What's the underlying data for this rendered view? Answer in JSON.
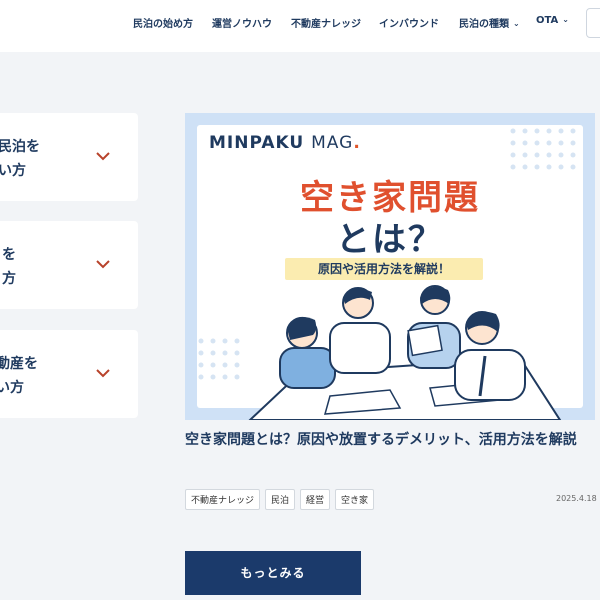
{
  "header": {
    "nav": [
      {
        "label": "民泊の始め方",
        "dropdown": false
      },
      {
        "label": "運営ノウハウ",
        "dropdown": false
      },
      {
        "label": "不動産ナレッジ",
        "dropdown": false
      },
      {
        "label": "インバウンド",
        "dropdown": false
      },
      {
        "label": "民泊の種類",
        "dropdown": true
      },
      {
        "label": "OTA",
        "dropdown": true
      }
    ]
  },
  "accordions": [
    {
      "label": "民泊を\nい方",
      "icon": "chevron-down-icon"
    },
    {
      "label": "を\n方",
      "icon": "chevron-down-icon"
    },
    {
      "label": "動産を\nい方",
      "icon": "chevron-down-icon"
    }
  ],
  "article": {
    "thumbnail": {
      "logo": "MINPAKU",
      "logo_suffix": "MAG",
      "logo_dot": ".",
      "headline_line1": "空き家問題",
      "headline_line2": "とは？",
      "subheading": "原因や活用方法を解説！"
    },
    "title": "空き家問題とは？原因や放置するデメリット、活用方法を解説",
    "tags": [
      "不動産ナレッジ",
      "民泊",
      "経営",
      "空き家"
    ],
    "date": "2025.4.18"
  },
  "more_button": "もっとみる",
  "colors": {
    "navy": "#1f3a5f",
    "button": "#1b3a6b",
    "accent_red": "#e0562b",
    "chevron": "#b8432b",
    "headline_red": "#e0502e",
    "thumb_bg": "#cfe1f6",
    "pill": "#fbecb0"
  }
}
